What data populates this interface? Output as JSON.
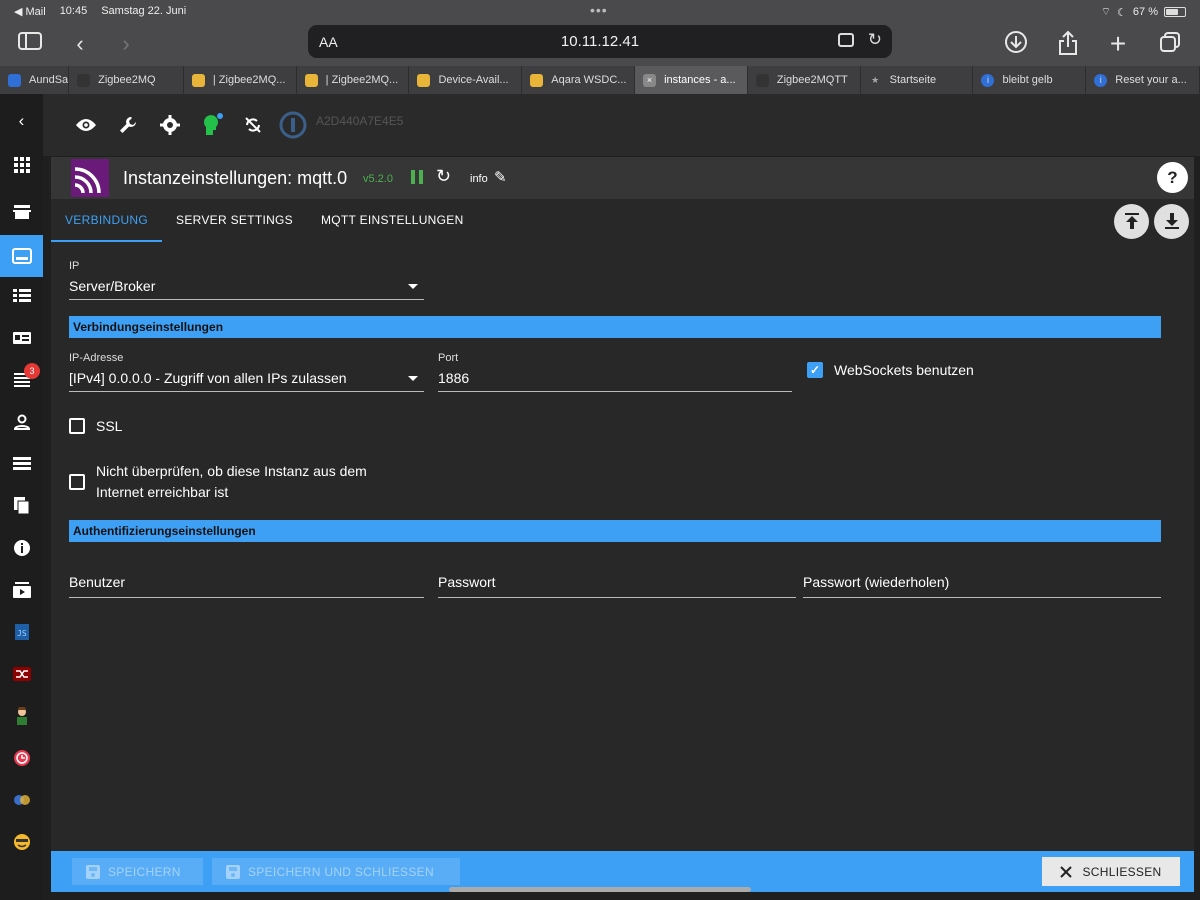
{
  "status": {
    "back_app": "◀ Mail",
    "time": "10:45",
    "date": "Samstag 22. Juni",
    "battery": "67 %",
    "battery_level": 0.67
  },
  "browser": {
    "aa": "AA",
    "url": "10.11.12.41",
    "tabs": [
      {
        "label": "AundSa",
        "color": "#2f6fd6",
        "icon": "square-icon"
      },
      {
        "label": "Zigbee2MQ",
        "color": "#333",
        "icon": "hat-icon"
      },
      {
        "label": "| Zigbee2MQ...",
        "color": "#e8b53a",
        "icon": "emoji-icon"
      },
      {
        "label": "| Zigbee2MQ...",
        "color": "#e8b53a",
        "icon": "emoji-icon"
      },
      {
        "label": "Device-Avail...",
        "color": "#e8b53a",
        "icon": "emoji-icon"
      },
      {
        "label": "Aqara WSDC...",
        "color": "#e8b53a",
        "icon": "emoji-icon"
      },
      {
        "label": "instances - a...",
        "color": "#888",
        "icon": "close-icon",
        "active": true
      },
      {
        "label": "Zigbee2MQTT",
        "color": "#333",
        "icon": "hat-icon"
      },
      {
        "label": "Startseite",
        "color": "#aaa",
        "icon": "star-icon"
      },
      {
        "label": "bleibt gelb",
        "color": "#2f6fd6",
        "icon": "info-icon"
      },
      {
        "label": "Reset your a...",
        "color": "#2f6fd6",
        "icon": "info-icon"
      }
    ]
  },
  "sidebar": {
    "log_badge": "3"
  },
  "adminbar": {
    "host_id": "A2D440A7E4E5"
  },
  "dialog": {
    "title": "Instanzeinstellungen: mqtt.0",
    "version": "v5.2.0",
    "info": "info",
    "help": "?",
    "tabs": [
      "VERBINDUNG",
      "SERVER SETTINGS",
      "MQTT EINSTELLUNGEN"
    ],
    "ip_label": "IP",
    "ip_value": "Server/Broker",
    "section_connection": "Verbindungseinstellungen",
    "ip_address_label": "IP-Adresse",
    "ip_address_value": "[IPv4] 0.0.0.0 - Zugriff von allen IPs zulassen",
    "port_label": "Port",
    "port_value": "1886",
    "websockets_label": "WebSockets benutzen",
    "websockets_checked": true,
    "ssl_label": "SSL",
    "ssl_checked": false,
    "no_check_label": "Nicht überprüfen, ob diese Instanz aus dem Internet erreichbar ist",
    "no_check_checked": false,
    "section_auth": "Authentifizierungseinstellungen",
    "user_placeholder": "Benutzer",
    "password_placeholder": "Passwort",
    "password_repeat_placeholder": "Passwort (wiederholen)"
  },
  "footer": {
    "save": "SPEICHERN",
    "save_close": "SPEICHERN UND SCHLIESSEN",
    "close": "SCHLIESSEN"
  }
}
